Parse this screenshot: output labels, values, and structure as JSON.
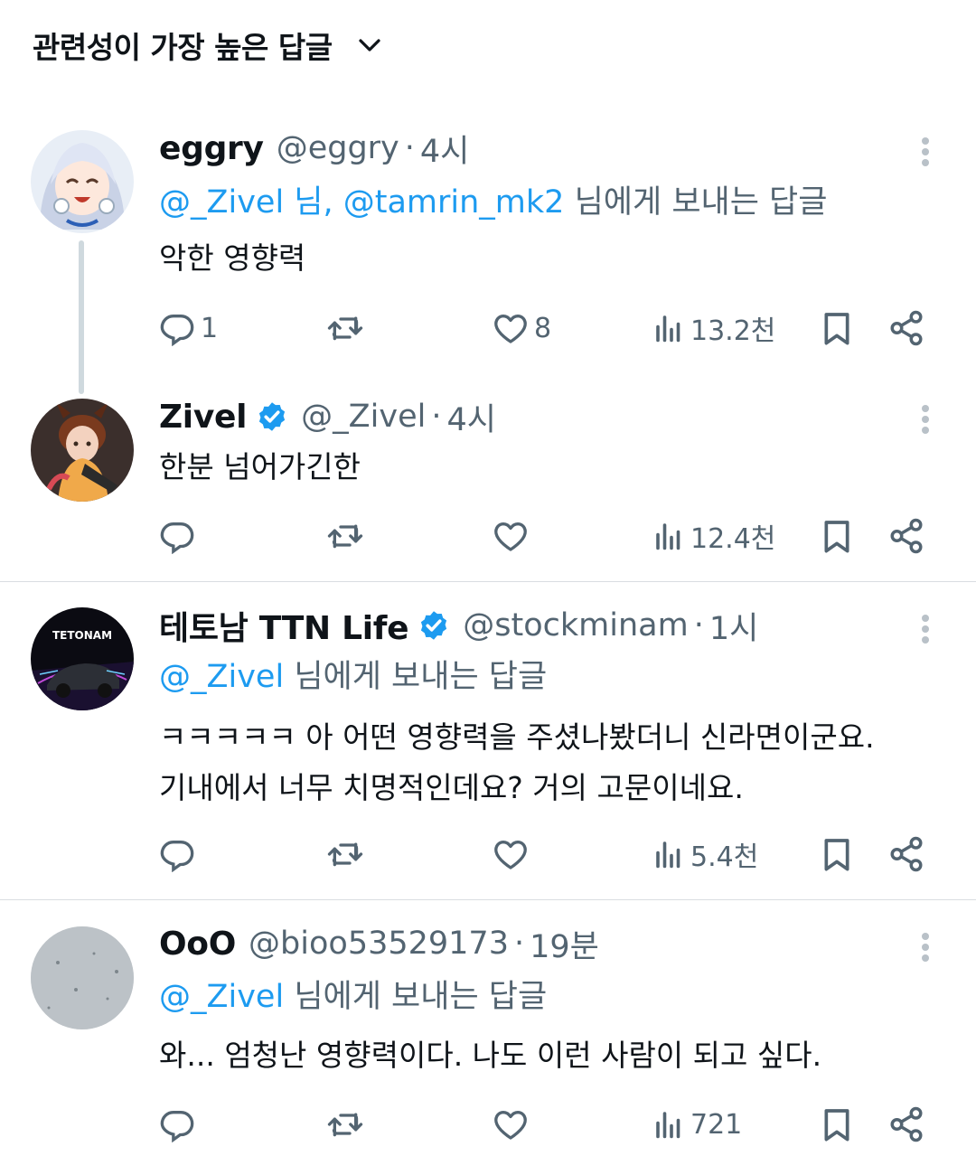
{
  "sort": {
    "label": "관련성이 가장 높은 답글"
  },
  "tweets": [
    {
      "display_name": "eggry",
      "verified": false,
      "handle": "@eggry",
      "time": "4시",
      "reply_to_mentions": "@_Zivel 님, @tamrin_mk2",
      "reply_to_suffix": "님에게 보내는 답글",
      "text_lines": [
        "악한 영향력"
      ],
      "replies": "1",
      "retweets": "",
      "likes": "8",
      "views": "13.2천"
    },
    {
      "display_name": "Zivel",
      "verified": true,
      "handle": "@_Zivel",
      "time": "4시",
      "text_lines": [
        "한분 넘어가긴한"
      ],
      "replies": "",
      "retweets": "",
      "likes": "",
      "views": "12.4천"
    },
    {
      "display_name": "테토남 TTN Life",
      "verified": true,
      "handle": "@stockminam",
      "time": "1시",
      "avatar_text": "TETONAM",
      "reply_to_mentions": "@_Zivel",
      "reply_to_suffix": "님에게 보내는 답글",
      "text_lines": [
        "ㅋㅋㅋㅋㅋ 아 어떤 영향력을 주셨나봤더니 신라면이군요.",
        "기내에서 너무 치명적인데요? 거의 고문이네요."
      ],
      "replies": "",
      "retweets": "",
      "likes": "",
      "views": "5.4천"
    },
    {
      "display_name": "OoO",
      "verified": false,
      "handle": "@bioo53529173",
      "time": "19분",
      "reply_to_mentions": "@_Zivel",
      "reply_to_suffix": "님에게 보내는 답글",
      "text_lines": [
        "와... 엄청난 영향력이다. 나도 이런 사람이 되고 싶다."
      ],
      "replies": "",
      "retweets": "",
      "likes": "",
      "views": "721"
    }
  ],
  "dot_separator": "·",
  "colors": {
    "link": "#1d9bf0",
    "muted": "#536471",
    "verified": "#1d9bf0",
    "divider": "#d9dde1"
  },
  "icons": [
    "chevron-down-icon",
    "more-icon",
    "reply-icon",
    "retweet-icon",
    "like-icon",
    "views-icon",
    "bookmark-icon",
    "share-icon",
    "verified-badge-icon"
  ]
}
